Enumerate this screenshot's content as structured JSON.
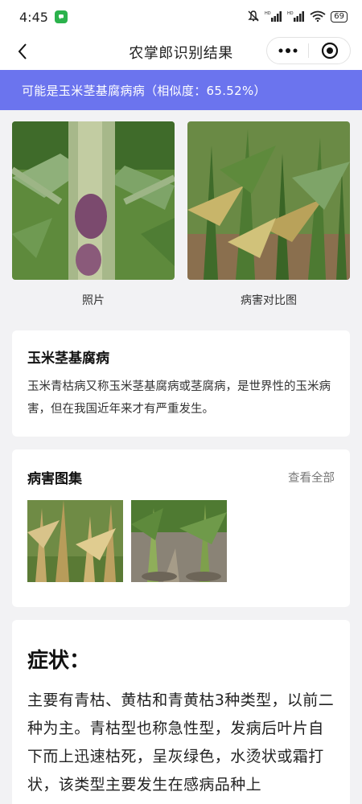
{
  "status_bar": {
    "time": "4:45",
    "battery": "69"
  },
  "nav": {
    "title": "农掌郎识别结果"
  },
  "result": {
    "text": "可能是玉米茎基腐病病（相似度：65.52%）"
  },
  "photos": [
    {
      "caption": "照片"
    },
    {
      "caption": "病害对比图"
    }
  ],
  "disease": {
    "title": "玉米茎基腐病",
    "description": "玉米青枯病又称玉米茎基腐病或茎腐病，是世界性的玉米病害，但在我国近年来才有严重发生。"
  },
  "gallery": {
    "title": "病害图集",
    "view_all": "查看全部"
  },
  "symptom": {
    "title": "症状：",
    "text": "主要有青枯、黄枯和青黄枯3种类型，以前二种为主。青枯型也称急性型，发病后叶片自下而上迅速枯死，呈灰绿色，水烫状或霜打状，该类型主要发生在感病品种上"
  },
  "colors": {
    "accent": "#6b74ee",
    "background": "#f2f2f4",
    "card": "#ffffff",
    "wechat_green": "#2bb24c"
  },
  "icons": [
    "wechat-icon",
    "mute-icon",
    "signal-icon",
    "wifi-icon",
    "battery-icon",
    "back-icon",
    "more-icon",
    "record-icon"
  ]
}
